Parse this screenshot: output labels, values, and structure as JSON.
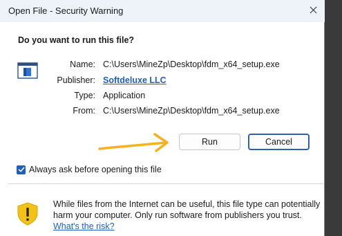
{
  "window": {
    "title": "Open File - Security Warning"
  },
  "question": "Do you want to run this file?",
  "file_info": {
    "name_label": "Name:",
    "name_value": "C:\\Users\\MineZp\\Desktop\\fdm_x64_setup.exe",
    "publisher_label": "Publisher:",
    "publisher_value": "Softdeluxe LLC",
    "type_label": "Type:",
    "type_value": "Application",
    "from_label": "From:",
    "from_value": "C:\\Users\\MineZp\\Desktop\\fdm_x64_setup.exe"
  },
  "buttons": {
    "run_label": "Run",
    "cancel_label": "Cancel"
  },
  "checkbox": {
    "label": "Always ask before opening this file",
    "checked": true
  },
  "warning": {
    "line1": "While files from the Internet can be useful, this file type can potentially",
    "line2": "harm your computer. Only run software from publishers you trust.",
    "risk_link": "What's the risk?"
  },
  "icons": {
    "close": "close-icon",
    "file": "application-file-icon",
    "arrow": "arrow-right-icon",
    "checkmark": "checkmark-icon",
    "shield": "warning-shield-icon"
  },
  "colors": {
    "accent": "#1f5fb6",
    "arrow": "#f2b31c",
    "shield": "#f2c21b",
    "titlebar": "#eef3fa"
  }
}
